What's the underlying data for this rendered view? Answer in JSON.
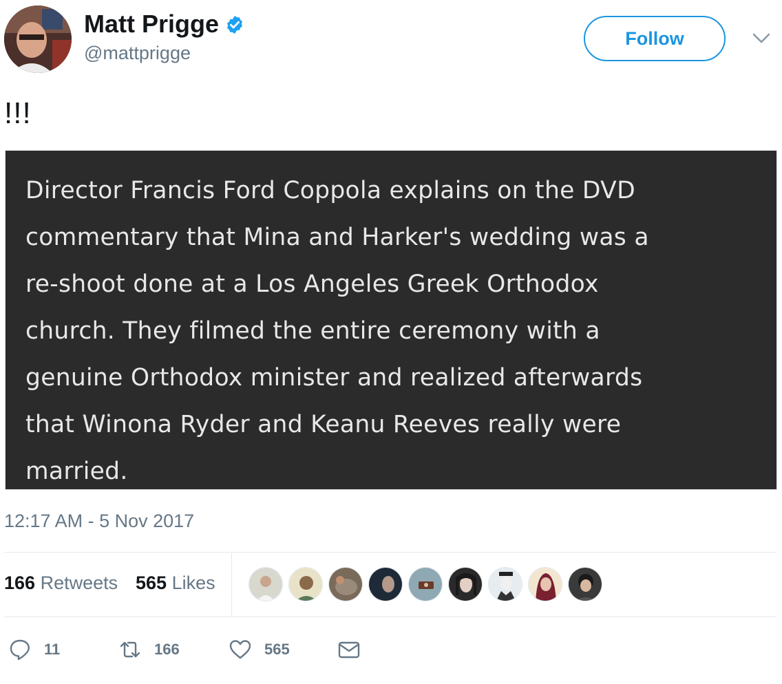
{
  "author": {
    "name": "Matt Prigge",
    "handle": "@mattprigge",
    "verified_icon": "verified-badge-icon"
  },
  "follow_label": "Follow",
  "tweet": {
    "text": "!!!",
    "media_lines": [
      "Director Francis Ford Coppola explains on the DVD",
      "commentary that Mina and Harker's wedding was a",
      "re-shoot done at a Los Angeles Greek Orthodox",
      "church. They filmed the entire ceremony with a",
      "genuine Orthodox minister and realized afterwards",
      "that Winona Ryder and Keanu Reeves really were",
      "married."
    ],
    "timestamp": "12:17 AM - 5 Nov 2017"
  },
  "stats": {
    "retweets_count": "166",
    "retweets_label": "Retweets",
    "likes_count": "565",
    "likes_label": "Likes"
  },
  "actions": {
    "reply_count": "11",
    "retweet_count": "166",
    "like_count": "565"
  },
  "colors": {
    "accent": "#1b95e0",
    "muted": "#657786",
    "media_bg": "#2b2b2b"
  }
}
